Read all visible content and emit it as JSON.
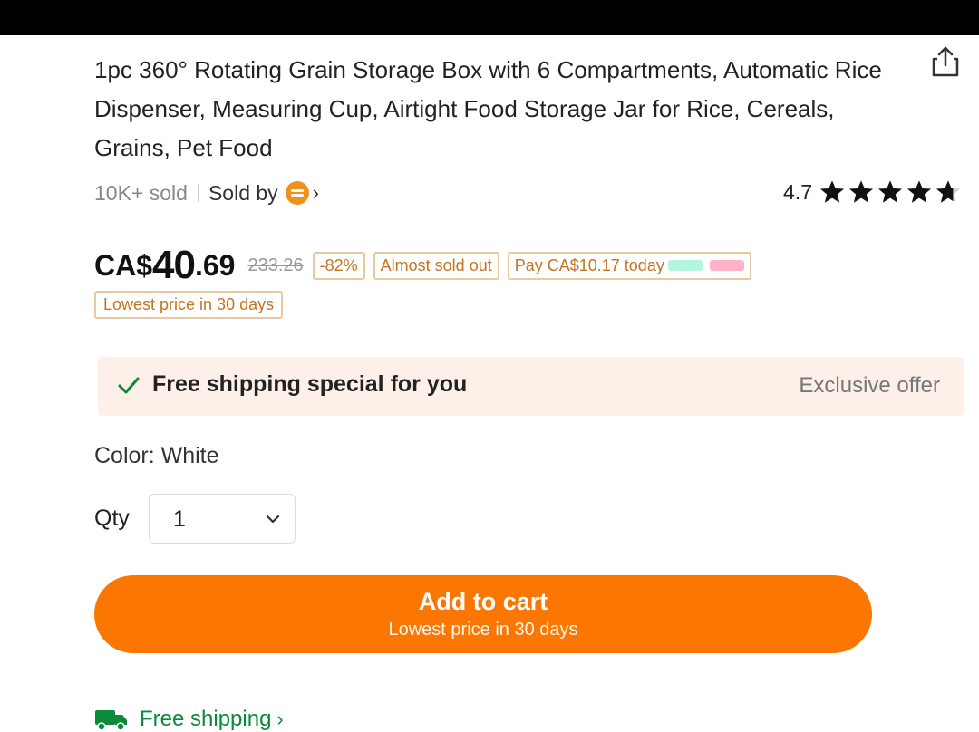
{
  "product": {
    "title": "1pc 360° Rotating Grain Storage Box with 6 Compartments, Automatic Rice Dispenser, Measuring Cup, Airtight Food Storage Jar for Rice, Cereals, Grains, Pet Food",
    "sold_count": "10K+ sold",
    "sold_by_label": "Sold by",
    "rating_value": "4.7",
    "rating_stars": 4.7
  },
  "pricing": {
    "currency": "CA$",
    "price_int": "40",
    "price_dec": ".69",
    "original_price": "233.26",
    "discount": "-82%",
    "stock_tag": "Almost sold out",
    "pay_today": "Pay CA$10.17 today",
    "lowest_price_tag": "Lowest price in 30 days"
  },
  "shipping": {
    "banner_text": "Free shipping special for you",
    "exclusive_label": "Exclusive offer",
    "footer_text": "Free shipping"
  },
  "options": {
    "color_label": "Color: White",
    "qty_label": "Qty",
    "qty_value": "1"
  },
  "cta": {
    "label": "Add to cart",
    "sublabel": "Lowest price in 30 days"
  },
  "colors": {
    "accent_orange": "#fb7701",
    "banner_bg": "#fdf0e8",
    "tag_border": "#e8c9a0",
    "tag_text": "#c47420",
    "green": "#0a8a3a"
  },
  "icons": [
    "share-icon",
    "store-icon",
    "chevron-right-icon",
    "star-icon",
    "check-icon",
    "chevron-down-icon",
    "truck-icon"
  ]
}
